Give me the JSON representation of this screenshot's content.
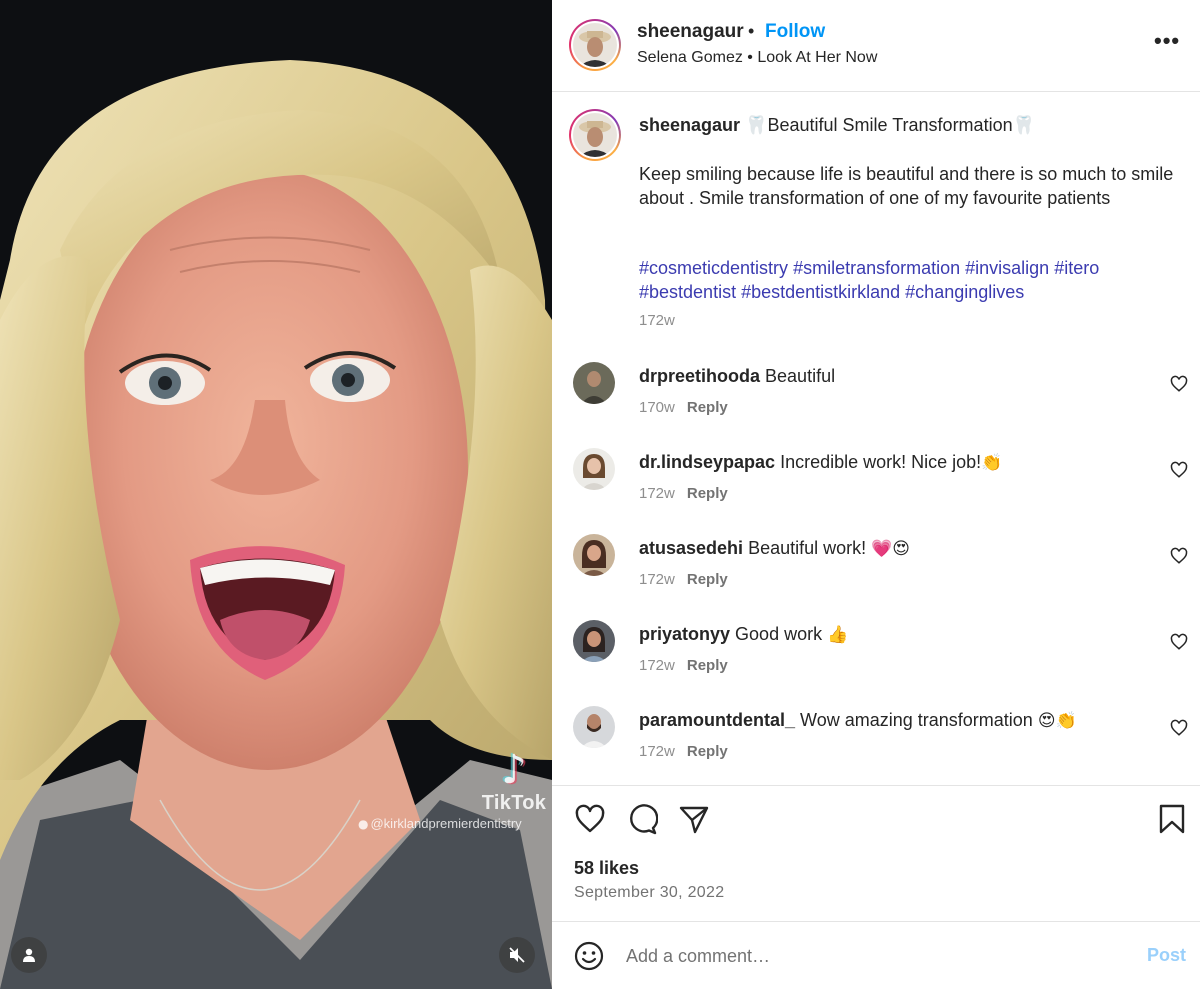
{
  "media": {
    "watermark_brand": "TikTok",
    "watermark_handle": "@kirklandpremierdentistry",
    "user_icon": "user-icon",
    "mute_icon": "speaker-muted-icon"
  },
  "header": {
    "username": "sheenagaur",
    "separator": "•",
    "follow_label": "Follow",
    "audio": "Selena Gomez • Look At Her Now",
    "more_label": "•••"
  },
  "caption": {
    "username": "sheenagaur",
    "title": "🦷Beautiful Smile Transformation🦷",
    "body": "Keep smiling because life is beautiful and there is so much to smile about . Smile transformation of one of my favourite patients",
    "hashtags": [
      "#cosmeticdentistry",
      "#smiletransformation",
      "#invisalign",
      "#itero",
      "#bestdentist",
      "#bestdentistkirkland",
      "#changinglives"
    ],
    "time": "172w"
  },
  "comments": [
    {
      "username": "drpreetihooda",
      "text": "Beautiful",
      "emoji": "",
      "time": "170w",
      "reply": "Reply"
    },
    {
      "username": "dr.lindseypapac",
      "text": "Incredible work! Nice job!",
      "emoji": "👏",
      "time": "172w",
      "reply": "Reply"
    },
    {
      "username": "atusasedehi",
      "text": "Beautiful work!",
      "emoji": "💗😍",
      "time": "172w",
      "reply": "Reply"
    },
    {
      "username": "priyatonyy",
      "text": "Good work",
      "emoji": "👍",
      "time": "172w",
      "reply": "Reply"
    },
    {
      "username": "paramountdental_",
      "text": "Wow amazing transformation",
      "emoji": "😍👏",
      "time": "172w",
      "reply": "Reply"
    }
  ],
  "actions": {
    "icons": [
      "heart-icon",
      "comment-icon",
      "share-icon",
      "bookmark-icon"
    ],
    "likes": "58 likes",
    "date": "September 30, 2022"
  },
  "add_comment": {
    "placeholder": "Add a comment…",
    "post_label": "Post"
  },
  "colors": {
    "accent": "#0095f6",
    "hashtag": "#3b3bb0",
    "muted": "#8e8e8e",
    "post_disabled": "#9ad0fb"
  }
}
